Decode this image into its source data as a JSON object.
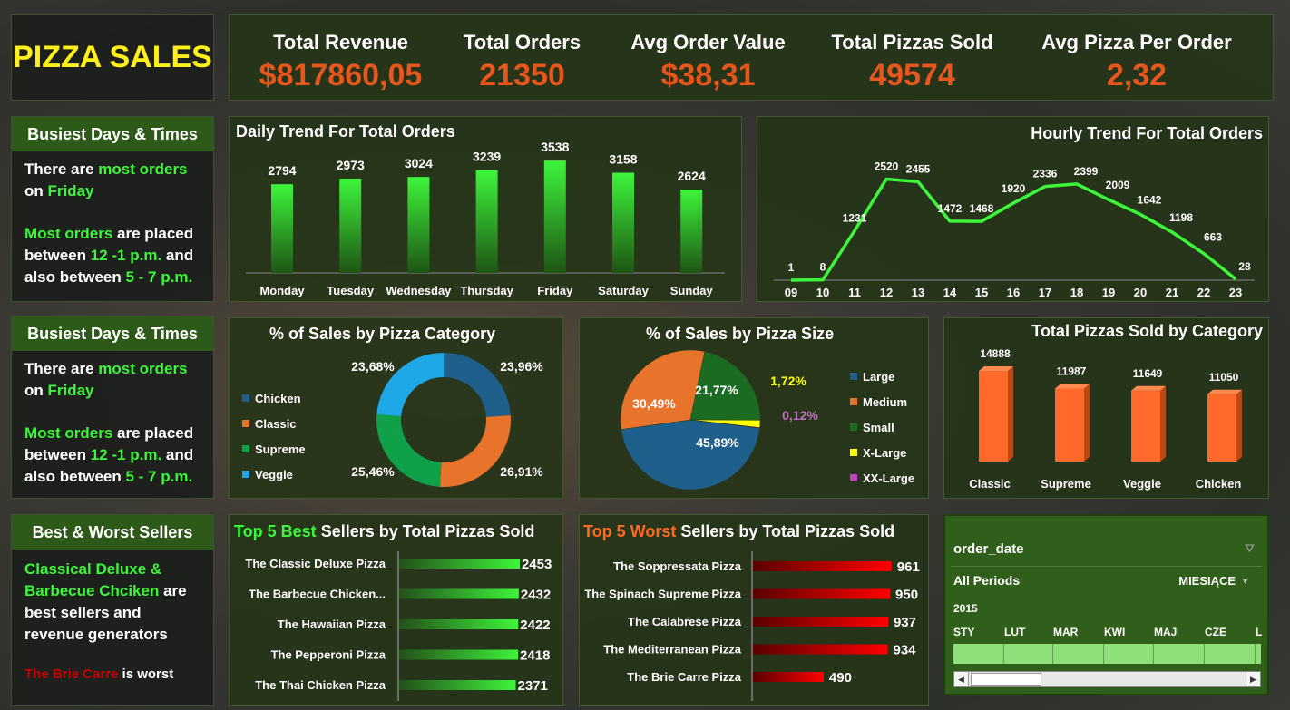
{
  "header": {
    "title": "PIZZA SALES"
  },
  "kpis": [
    {
      "label": "Total Revenue",
      "value": "$817860,05"
    },
    {
      "label": "Total Orders",
      "value": "21350"
    },
    {
      "label": "Avg Order Value",
      "value": "$38,31"
    },
    {
      "label": "Total Pizzas Sold",
      "value": "49574"
    },
    {
      "label": "Avg Pizza Per Order",
      "value": "2,32"
    }
  ],
  "note1": {
    "title": "Busiest Days & Times",
    "l1a": "There are ",
    "l1b": "most orders",
    "l2a": "on ",
    "l2b": "Friday",
    "l3a": "Most orders",
    "l3b": " are placed",
    "l4a": "between ",
    "l4b": "12 -1 p.m.",
    "l4c": " and",
    "l5a": "also between ",
    "l5b": "5 - 7 p.m."
  },
  "note2": {
    "title": "Busiest Days & Times",
    "l1a": "There are ",
    "l1b": "most orders",
    "l2a": "on ",
    "l2b": "Friday",
    "l3a": "Most orders",
    "l3b": " are placed",
    "l4a": "between ",
    "l4b": "12 -1 p.m.",
    "l4c": " and",
    "l5a": "also between ",
    "l5b": "5 - 7 p.m."
  },
  "note3": {
    "title": "Best & Worst Sellers",
    "l1": "Classical Deluxe &",
    "l2a": "Barbecue Chciken",
    "l2b": " are",
    "l3": "best sellers and",
    "l4": "revenue generators",
    "l5a": "The Brie Carre",
    "l5b": " is worst"
  },
  "daily": {
    "title": "Daily Trend For Total Orders"
  },
  "hourly": {
    "title": "Hourly Trend For Total Orders"
  },
  "category_pct": {
    "title": "% of Sales by Pizza Category"
  },
  "size_pct": {
    "title": "% of Sales by Pizza Size"
  },
  "cat_sold": {
    "title": "Total Pizzas Sold by Category"
  },
  "best": {
    "title_a": "Top 5 Best",
    "title_b": " Sellers by Total Pizzas Sold"
  },
  "worst": {
    "title_a": "Top 5 Worst",
    "title_b": " Sellers by Total Pizzas Sold"
  },
  "slicer": {
    "field": "order_date",
    "all": "All Periods",
    "level": "MIESIĄCE",
    "year": "2015",
    "months": [
      "STY",
      "LUT",
      "MAR",
      "KWI",
      "MAJ",
      "CZE",
      "L"
    ]
  },
  "colors": {
    "bar_green": "#3df53a",
    "orange": "#ff6a2a",
    "chicken": "#1f5f8b",
    "classic": "#e8742b",
    "supreme": "#10a048",
    "veggie": "#1fa8e8",
    "large": "#1f5f8b",
    "medium": "#e8742b",
    "small": "#1c6b22",
    "xlarge": "#ffff00",
    "xxlarge": "#c040c0"
  },
  "chart_data": [
    {
      "type": "bar",
      "title": "Daily Trend For Total Orders",
      "categories": [
        "Monday",
        "Tuesday",
        "Wednesday",
        "Thursday",
        "Friday",
        "Saturday",
        "Sunday"
      ],
      "values": [
        2794,
        2973,
        3024,
        3239,
        3538,
        3158,
        2624
      ]
    },
    {
      "type": "line",
      "title": "Hourly Trend For Total Orders",
      "x": [
        "09",
        "10",
        "11",
        "12",
        "13",
        "14",
        "15",
        "16",
        "17",
        "18",
        "19",
        "20",
        "21",
        "22",
        "23"
      ],
      "values": [
        1,
        8,
        1231,
        2520,
        2455,
        1472,
        1468,
        1920,
        2336,
        2399,
        2009,
        1642,
        1198,
        663,
        28
      ]
    },
    {
      "type": "pie",
      "title": "% of Sales by Pizza Category",
      "categories": [
        "Chicken",
        "Classic",
        "Supreme",
        "Veggie"
      ],
      "values": [
        23.96,
        26.91,
        25.46,
        23.68
      ],
      "labels": [
        "23,96%",
        "26,91%",
        "25,46%",
        "23,68%"
      ]
    },
    {
      "type": "pie",
      "title": "% of Sales by Pizza Size",
      "categories": [
        "Large",
        "Medium",
        "Small",
        "X-Large",
        "XX-Large"
      ],
      "values": [
        45.89,
        30.49,
        21.77,
        1.72,
        0.12
      ],
      "labels": [
        "45,89%",
        "30,49%",
        "21,77%",
        "1,72%",
        "0,12%"
      ]
    },
    {
      "type": "bar",
      "title": "Total Pizzas Sold by Category",
      "categories": [
        "Classic",
        "Supreme",
        "Veggie",
        "Chicken"
      ],
      "values": [
        14888,
        11987,
        11649,
        11050
      ]
    },
    {
      "type": "bar",
      "title": "Top 5 Best Sellers by Total Pizzas Sold",
      "categories": [
        "The Classic Deluxe Pizza",
        "The Barbecue Chicken...",
        "The Hawaiian Pizza",
        "The Pepperoni Pizza",
        "The Thai Chicken Pizza"
      ],
      "values": [
        2453,
        2432,
        2422,
        2418,
        2371
      ]
    },
    {
      "type": "bar",
      "title": "Top 5 Worst Sellers by Total Pizzas Sold",
      "categories": [
        "The Soppressata Pizza",
        "The Spinach Supreme Pizza",
        "The Calabrese Pizza",
        "The Mediterranean Pizza",
        "The Brie Carre Pizza"
      ],
      "values": [
        961,
        950,
        937,
        934,
        490
      ]
    }
  ]
}
